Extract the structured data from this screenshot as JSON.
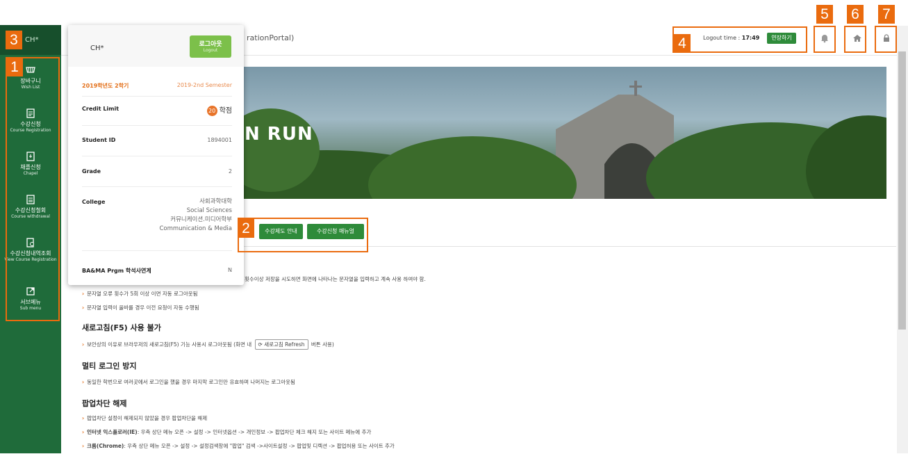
{
  "sidebar": {
    "user": "CH*",
    "items": [
      {
        "icon": "cart-icon",
        "label_ko": "장바구니",
        "label_en": "Wish List"
      },
      {
        "icon": "document-icon",
        "label_ko": "수강신청",
        "label_en": "Course Registration"
      },
      {
        "icon": "document-check-icon",
        "label_ko": "채플신청",
        "label_en": "Chapel"
      },
      {
        "icon": "document-cancel-icon",
        "label_ko": "수강신청철회",
        "label_en": "Course withdrawal"
      },
      {
        "icon": "document-search-icon",
        "label_ko": "수강신청내역조회",
        "label_en": "View Course Registration"
      },
      {
        "icon": "external-link-icon",
        "label_ko": "서브메뉴",
        "label_en": "Sub menu"
      }
    ]
  },
  "header": {
    "portal_title": "rationPortal)",
    "logout_label": "Logout time : ",
    "logout_time": "17:49",
    "extend_button": "연장하기",
    "icons": [
      "bell-icon",
      "home-icon",
      "lock-icon"
    ]
  },
  "banner": {
    "text": "N RUN"
  },
  "buttons": {
    "guide": "수강제도 안내",
    "manual": "수강신청 매뉴얼"
  },
  "popup": {
    "user": "CH*",
    "logout_ko": "로그아웃",
    "logout_en": "Logout",
    "semester_ko": "2019학년도 2학기",
    "semester_en": "2019-2nd Semester",
    "credit_label": "Credit Limit",
    "credit_value": "20",
    "credit_unit": "학점",
    "student_id_label": "Student ID",
    "student_id": "1894001",
    "grade_label": "Grade",
    "grade": "2",
    "college_label": "College",
    "college_ko": "사회과학대학",
    "college_en": "Social Sciences",
    "dept_ko": "커뮤니케이션.미디어학부",
    "dept_en": "Communication & Media",
    "bama_label": "BA&MA Prgm 학석사연계",
    "bama_value": "N"
  },
  "content": {
    "line0": "횟수이상 저장을 시도하면 화면에 나타나는 문자열을 입력하고 계속 사용 하여야 함.",
    "line1": "문자열 오류 횟수가 5회 이상 이면 자동 로그아웃됨",
    "line2": "문자열 입력이 올바를 경우 이전 요청이 자동 수행됨",
    "sec1_title": "새로고침(F5) 사용 불가",
    "sec1_line_a": "보안상의 이유로 브라우저의 새로고침(F5) 기능 사용시 로그아웃됨 (화면 내",
    "sec1_chip": "새로고침 Refresh",
    "sec1_line_b": "버튼 사용)",
    "sec2_title": "멀티 로그인 방지",
    "sec2_line": "동일한 학번으로 여러곳에서 로그인을 했을 경우 마지막 로그인만 유효하며 나머지는 로그아웃됨",
    "sec3_title": "팝업차단 해제",
    "sec3_line1": "팝업차단 설정이 해제되지 않았을 경우 팝업차단을 해제",
    "sec3_line2_bold": "인터넷 익스플로러(IE)",
    "sec3_line2": ": 우측 상단 메뉴 오픈 -> 설정 -> 인터넷옵션 -> 개인정보 -> 팝업차단 체크 해지 또는 사이트 메뉴에 추가",
    "sec3_line3_bold": "크롬(Chrome)",
    "sec3_line3": ": 우측 상단 메뉴 오픈 -> 설정 -> 설정검색창에 \"팝업\" 검색 ->사이트설정 -> 팝업및 디렉션 -> 팝업허용 또는 사이트 추가"
  },
  "markers": [
    "1",
    "2",
    "3",
    "4",
    "5",
    "6",
    "7"
  ],
  "colors": {
    "sidebar": "#1f6b3a",
    "accent_orange": "#ea6b0e",
    "button_green": "#2e8b3a"
  }
}
